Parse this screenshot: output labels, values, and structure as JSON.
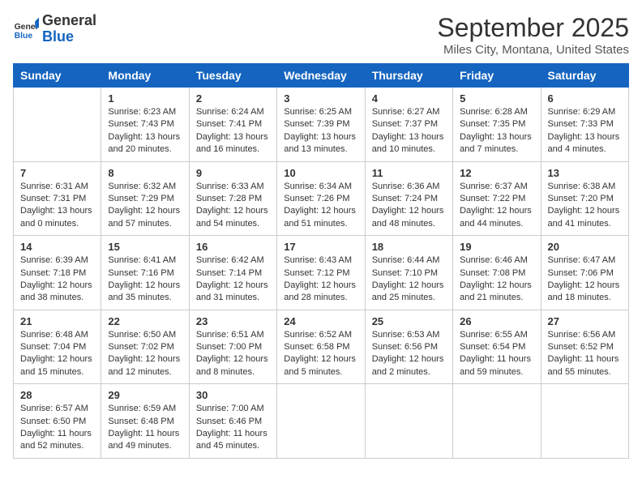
{
  "header": {
    "logo": {
      "general": "General",
      "blue": "Blue"
    },
    "title": "September 2025",
    "subtitle": "Miles City, Montana, United States"
  },
  "days_of_week": [
    "Sunday",
    "Monday",
    "Tuesday",
    "Wednesday",
    "Thursday",
    "Friday",
    "Saturday"
  ],
  "weeks": [
    [
      {
        "day": "",
        "info": ""
      },
      {
        "day": "1",
        "info": "Sunrise: 6:23 AM\nSunset: 7:43 PM\nDaylight: 13 hours\nand 20 minutes."
      },
      {
        "day": "2",
        "info": "Sunrise: 6:24 AM\nSunset: 7:41 PM\nDaylight: 13 hours\nand 16 minutes."
      },
      {
        "day": "3",
        "info": "Sunrise: 6:25 AM\nSunset: 7:39 PM\nDaylight: 13 hours\nand 13 minutes."
      },
      {
        "day": "4",
        "info": "Sunrise: 6:27 AM\nSunset: 7:37 PM\nDaylight: 13 hours\nand 10 minutes."
      },
      {
        "day": "5",
        "info": "Sunrise: 6:28 AM\nSunset: 7:35 PM\nDaylight: 13 hours\nand 7 minutes."
      },
      {
        "day": "6",
        "info": "Sunrise: 6:29 AM\nSunset: 7:33 PM\nDaylight: 13 hours\nand 4 minutes."
      }
    ],
    [
      {
        "day": "7",
        "info": "Sunrise: 6:31 AM\nSunset: 7:31 PM\nDaylight: 13 hours\nand 0 minutes."
      },
      {
        "day": "8",
        "info": "Sunrise: 6:32 AM\nSunset: 7:29 PM\nDaylight: 12 hours\nand 57 minutes."
      },
      {
        "day": "9",
        "info": "Sunrise: 6:33 AM\nSunset: 7:28 PM\nDaylight: 12 hours\nand 54 minutes."
      },
      {
        "day": "10",
        "info": "Sunrise: 6:34 AM\nSunset: 7:26 PM\nDaylight: 12 hours\nand 51 minutes."
      },
      {
        "day": "11",
        "info": "Sunrise: 6:36 AM\nSunset: 7:24 PM\nDaylight: 12 hours\nand 48 minutes."
      },
      {
        "day": "12",
        "info": "Sunrise: 6:37 AM\nSunset: 7:22 PM\nDaylight: 12 hours\nand 44 minutes."
      },
      {
        "day": "13",
        "info": "Sunrise: 6:38 AM\nSunset: 7:20 PM\nDaylight: 12 hours\nand 41 minutes."
      }
    ],
    [
      {
        "day": "14",
        "info": "Sunrise: 6:39 AM\nSunset: 7:18 PM\nDaylight: 12 hours\nand 38 minutes."
      },
      {
        "day": "15",
        "info": "Sunrise: 6:41 AM\nSunset: 7:16 PM\nDaylight: 12 hours\nand 35 minutes."
      },
      {
        "day": "16",
        "info": "Sunrise: 6:42 AM\nSunset: 7:14 PM\nDaylight: 12 hours\nand 31 minutes."
      },
      {
        "day": "17",
        "info": "Sunrise: 6:43 AM\nSunset: 7:12 PM\nDaylight: 12 hours\nand 28 minutes."
      },
      {
        "day": "18",
        "info": "Sunrise: 6:44 AM\nSunset: 7:10 PM\nDaylight: 12 hours\nand 25 minutes."
      },
      {
        "day": "19",
        "info": "Sunrise: 6:46 AM\nSunset: 7:08 PM\nDaylight: 12 hours\nand 21 minutes."
      },
      {
        "day": "20",
        "info": "Sunrise: 6:47 AM\nSunset: 7:06 PM\nDaylight: 12 hours\nand 18 minutes."
      }
    ],
    [
      {
        "day": "21",
        "info": "Sunrise: 6:48 AM\nSunset: 7:04 PM\nDaylight: 12 hours\nand 15 minutes."
      },
      {
        "day": "22",
        "info": "Sunrise: 6:50 AM\nSunset: 7:02 PM\nDaylight: 12 hours\nand 12 minutes."
      },
      {
        "day": "23",
        "info": "Sunrise: 6:51 AM\nSunset: 7:00 PM\nDaylight: 12 hours\nand 8 minutes."
      },
      {
        "day": "24",
        "info": "Sunrise: 6:52 AM\nSunset: 6:58 PM\nDaylight: 12 hours\nand 5 minutes."
      },
      {
        "day": "25",
        "info": "Sunrise: 6:53 AM\nSunset: 6:56 PM\nDaylight: 12 hours\nand 2 minutes."
      },
      {
        "day": "26",
        "info": "Sunrise: 6:55 AM\nSunset: 6:54 PM\nDaylight: 11 hours\nand 59 minutes."
      },
      {
        "day": "27",
        "info": "Sunrise: 6:56 AM\nSunset: 6:52 PM\nDaylight: 11 hours\nand 55 minutes."
      }
    ],
    [
      {
        "day": "28",
        "info": "Sunrise: 6:57 AM\nSunset: 6:50 PM\nDaylight: 11 hours\nand 52 minutes."
      },
      {
        "day": "29",
        "info": "Sunrise: 6:59 AM\nSunset: 6:48 PM\nDaylight: 11 hours\nand 49 minutes."
      },
      {
        "day": "30",
        "info": "Sunrise: 7:00 AM\nSunset: 6:46 PM\nDaylight: 11 hours\nand 45 minutes."
      },
      {
        "day": "",
        "info": ""
      },
      {
        "day": "",
        "info": ""
      },
      {
        "day": "",
        "info": ""
      },
      {
        "day": "",
        "info": ""
      }
    ]
  ]
}
